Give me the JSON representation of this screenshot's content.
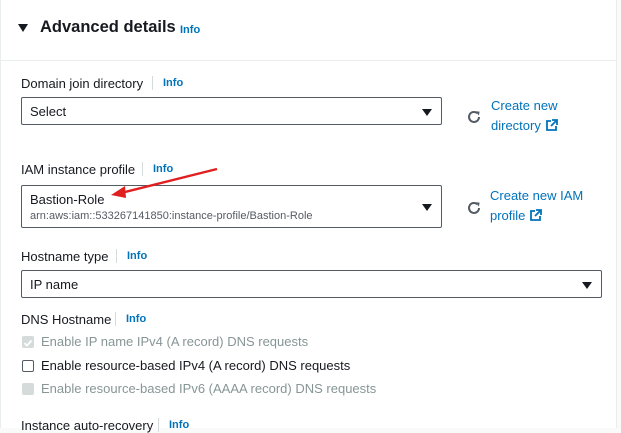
{
  "section": {
    "title": "Advanced details",
    "info": "Info"
  },
  "domain_join": {
    "label": "Domain join directory",
    "info": "Info",
    "value": "Select",
    "create_link_line1": "Create new",
    "create_link_line2": "directory"
  },
  "iam_profile": {
    "label": "IAM instance profile",
    "info": "Info",
    "value": "Bastion-Role",
    "subvalue": "arn:aws:iam::533267141850:instance-profile/Bastion-Role",
    "create_link_line1": "Create new IAM",
    "create_link_line2": "profile"
  },
  "hostname_type": {
    "label": "Hostname type",
    "info": "Info",
    "value": "IP name"
  },
  "dns_hostname": {
    "label": "DNS Hostname",
    "info": "Info",
    "options": [
      {
        "label": "Enable IP name IPv4 (A record) DNS requests",
        "checked": true,
        "disabled": true
      },
      {
        "label": "Enable resource-based IPv4 (A record) DNS requests",
        "checked": false,
        "disabled": false
      },
      {
        "label": "Enable resource-based IPv6 (AAAA record) DNS requests",
        "checked": false,
        "disabled": true
      }
    ]
  },
  "instance_auto_recovery": {
    "label": "Instance auto-recovery",
    "info": "Info"
  },
  "colors": {
    "link": "#0073bb",
    "annotation_arrow": "#e02020",
    "border": "#545b64"
  }
}
